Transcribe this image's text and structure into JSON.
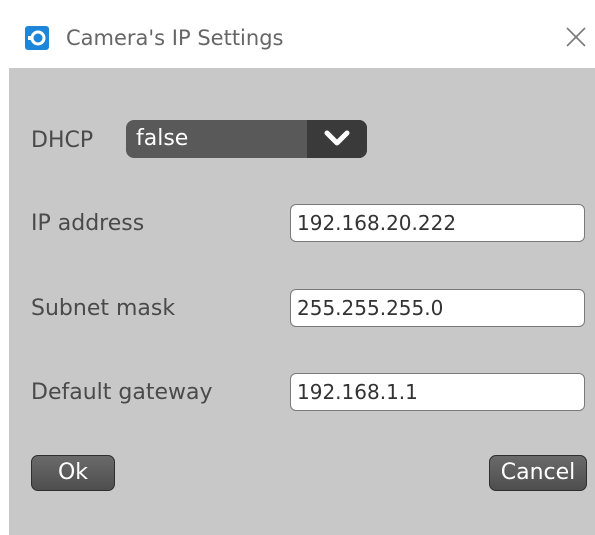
{
  "window": {
    "title": "Camera's IP Settings",
    "app_icon": "camera-app-icon",
    "close_icon": "close-icon"
  },
  "form": {
    "dhcp": {
      "label": "DHCP",
      "value": "false",
      "arrow_icon": "chevron-down-icon"
    },
    "ip_address": {
      "label": "IP address",
      "value": "192.168.20.222"
    },
    "subnet_mask": {
      "label": "Subnet mask",
      "value": "255.255.255.0"
    },
    "default_gateway": {
      "label": "Default gateway",
      "value": "192.168.1.1"
    }
  },
  "buttons": {
    "ok_label": "Ok",
    "cancel_label": "Cancel"
  },
  "colors": {
    "window_bg": "#c8c8c8",
    "accent": "#1e86d8",
    "button_bg": "#5a5a5a"
  }
}
